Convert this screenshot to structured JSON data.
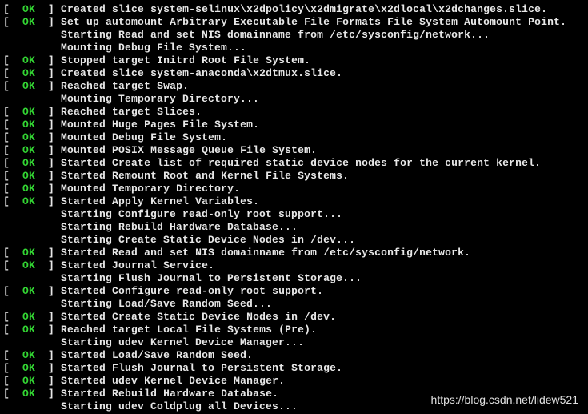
{
  "status_ok": "OK",
  "lines": [
    {
      "status": true,
      "text": "Created slice system-selinux\\x2dpolicy\\x2dmigrate\\x2dlocal\\x2dchanges.slice."
    },
    {
      "status": true,
      "text": "Set up automount Arbitrary Executable File Formats File System Automount Point."
    },
    {
      "status": false,
      "text": "Starting Read and set NIS domainname from /etc/sysconfig/network..."
    },
    {
      "status": false,
      "text": "Mounting Debug File System..."
    },
    {
      "status": true,
      "text": "Stopped target Initrd Root File System."
    },
    {
      "status": true,
      "text": "Created slice system-anaconda\\x2dtmux.slice."
    },
    {
      "status": true,
      "text": "Reached target Swap."
    },
    {
      "status": false,
      "text": "Mounting Temporary Directory..."
    },
    {
      "status": true,
      "text": "Reached target Slices."
    },
    {
      "status": true,
      "text": "Mounted Huge Pages File System."
    },
    {
      "status": true,
      "text": "Mounted Debug File System."
    },
    {
      "status": true,
      "text": "Mounted POSIX Message Queue File System."
    },
    {
      "status": true,
      "text": "Started Create list of required static device nodes for the current kernel."
    },
    {
      "status": true,
      "text": "Started Remount Root and Kernel File Systems."
    },
    {
      "status": true,
      "text": "Mounted Temporary Directory."
    },
    {
      "status": true,
      "text": "Started Apply Kernel Variables."
    },
    {
      "status": false,
      "text": "Starting Configure read-only root support..."
    },
    {
      "status": false,
      "text": "Starting Rebuild Hardware Database..."
    },
    {
      "status": false,
      "text": "Starting Create Static Device Nodes in /dev..."
    },
    {
      "status": true,
      "text": "Started Read and set NIS domainname from /etc/sysconfig/network."
    },
    {
      "status": true,
      "text": "Started Journal Service."
    },
    {
      "status": false,
      "text": "Starting Flush Journal to Persistent Storage..."
    },
    {
      "status": true,
      "text": "Started Configure read-only root support."
    },
    {
      "status": false,
      "text": "Starting Load/Save Random Seed..."
    },
    {
      "status": true,
      "text": "Started Create Static Device Nodes in /dev."
    },
    {
      "status": true,
      "text": "Reached target Local File Systems (Pre)."
    },
    {
      "status": false,
      "text": "Starting udev Kernel Device Manager..."
    },
    {
      "status": true,
      "text": "Started Load/Save Random Seed."
    },
    {
      "status": true,
      "text": "Started Flush Journal to Persistent Storage."
    },
    {
      "status": true,
      "text": "Started udev Kernel Device Manager."
    },
    {
      "status": true,
      "text": "Started Rebuild Hardware Database."
    },
    {
      "status": false,
      "text": "Starting udev Coldplug all Devices..."
    }
  ],
  "watermark": "https://blog.csdn.net/lidew521"
}
